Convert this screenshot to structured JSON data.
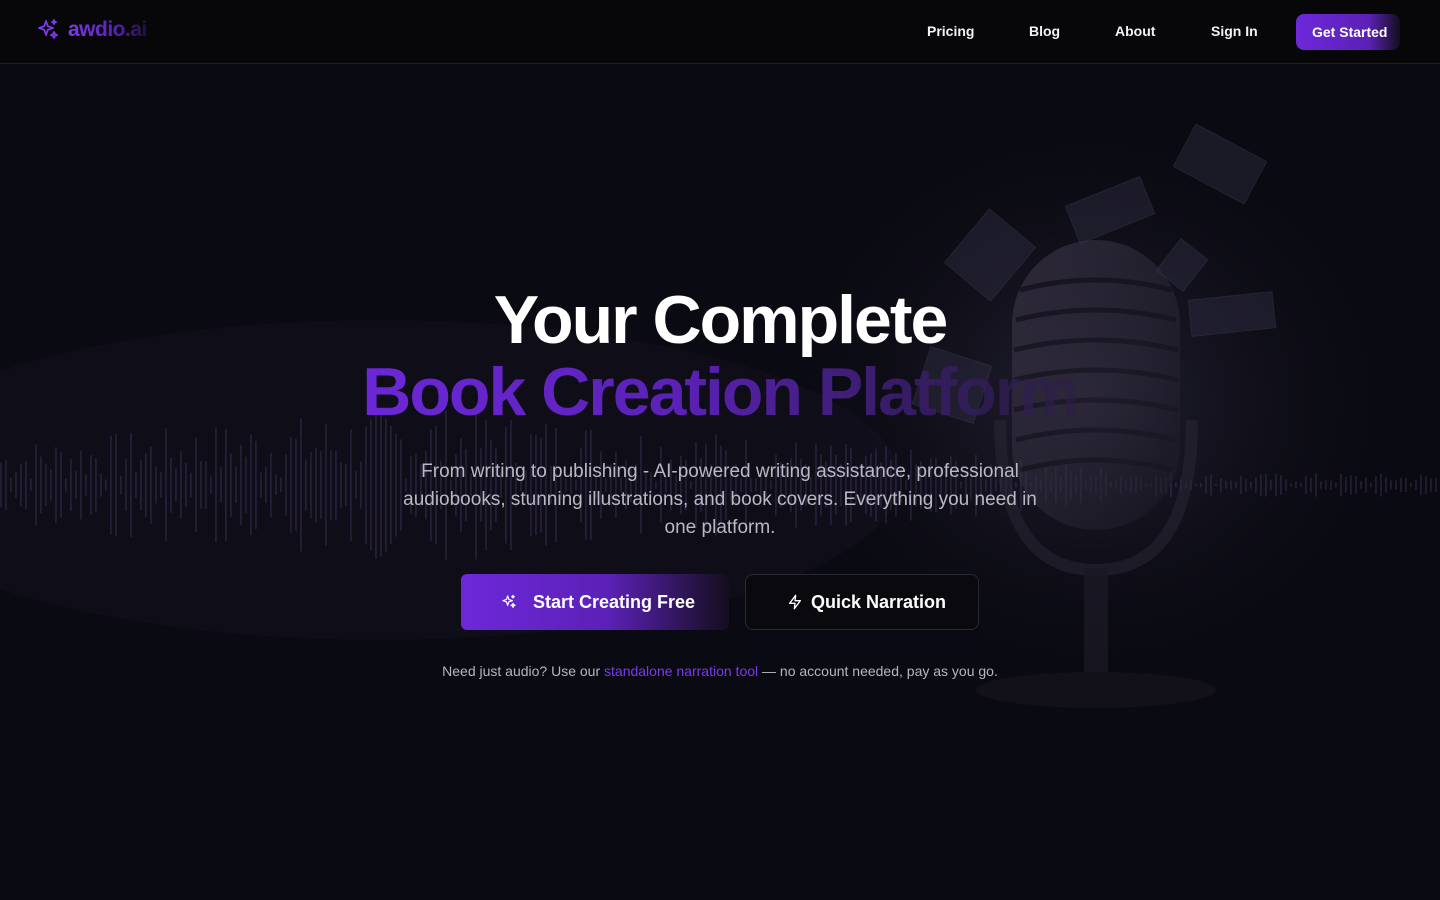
{
  "brand": {
    "name": "awdio.ai",
    "logo_icon": "sparkles-icon",
    "accent_color": "#6d28d9"
  },
  "nav": {
    "items": [
      {
        "label": "Pricing"
      },
      {
        "label": "Blog"
      },
      {
        "label": "About"
      },
      {
        "label": "Sign In"
      }
    ],
    "cta_label": "Get Started"
  },
  "hero": {
    "title_line1": "Your Complete",
    "title_line2": "Book Creation Platform",
    "subtitle": "From writing to publishing - AI-powered writing assistance, professional audiobooks, stunning illustrations, and book covers. Everything you need in one platform.",
    "primary_button": {
      "label": "Start Creating Free",
      "icon": "sparkles-icon"
    },
    "secondary_button": {
      "label": "Quick Narration",
      "icon": "lightning-icon"
    },
    "note": {
      "prefix": "Need just audio? Use our ",
      "link": "standalone narration tool",
      "suffix": " — no account needed, pay as you go."
    }
  }
}
